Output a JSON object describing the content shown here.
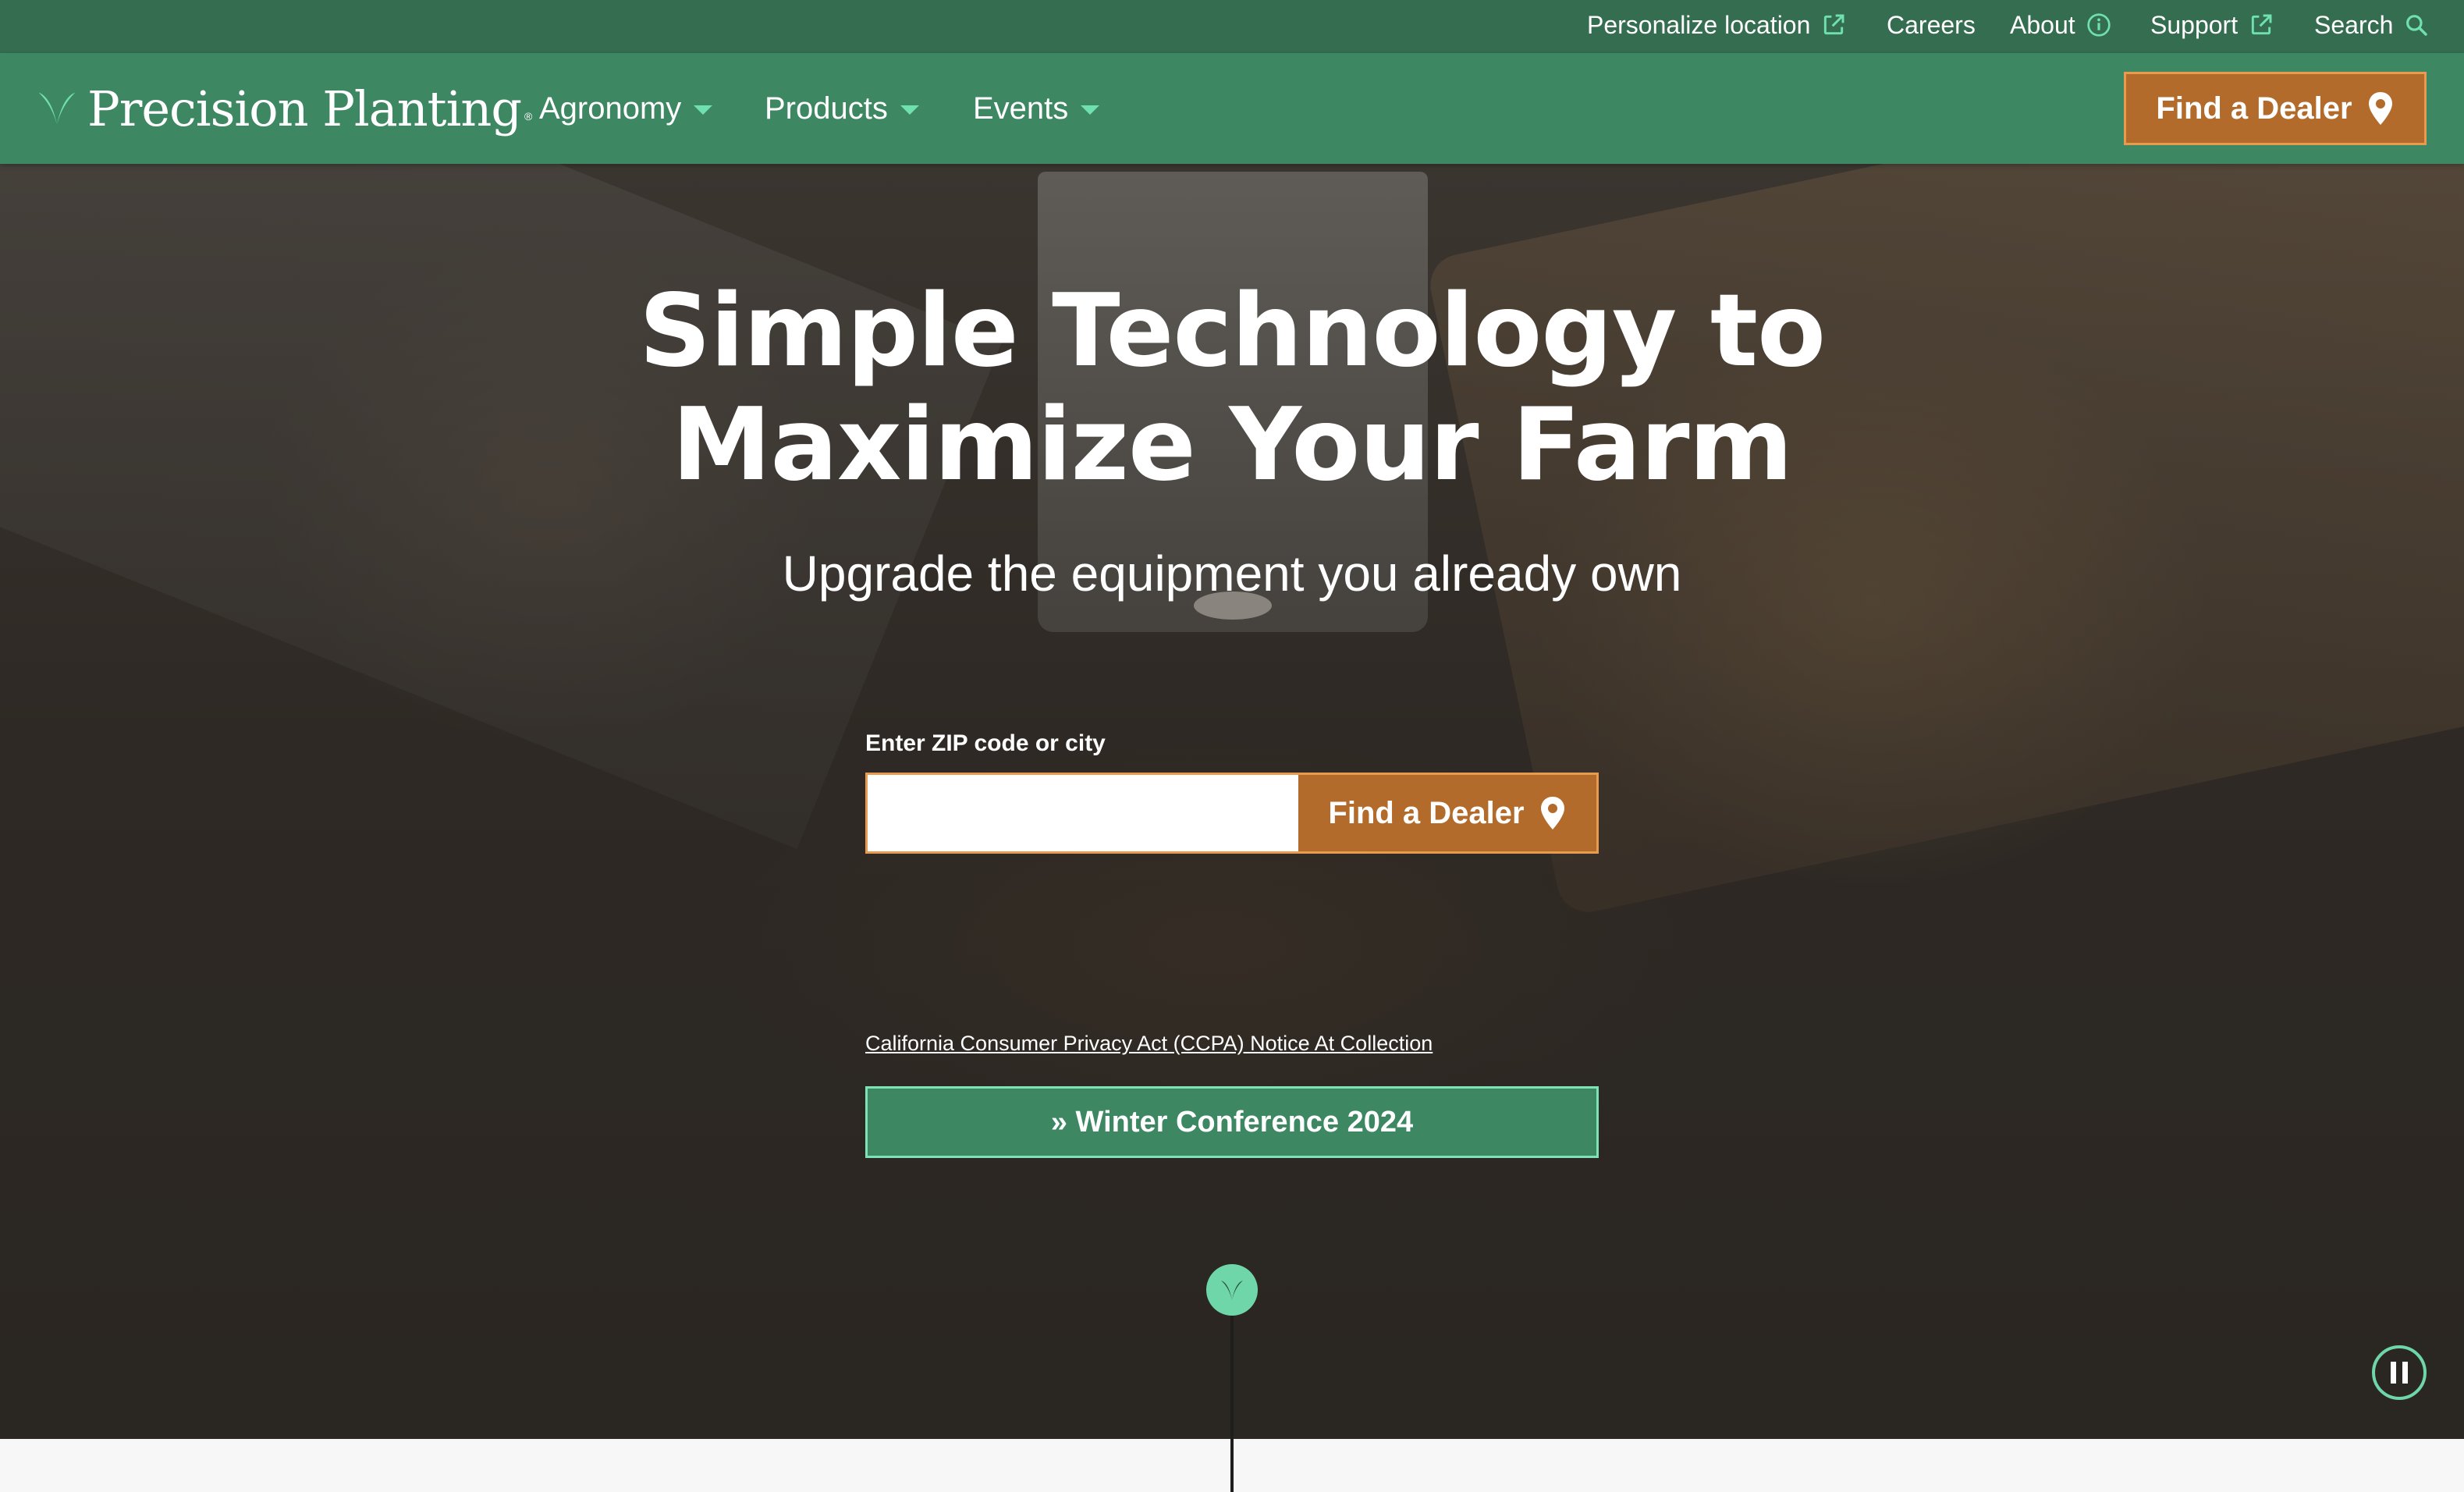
{
  "utility_nav": {
    "items": [
      {
        "label": "Personalize location",
        "icon": "external-link-icon"
      },
      {
        "label": "Careers",
        "icon": ""
      },
      {
        "label": "About",
        "icon": "info-icon"
      },
      {
        "label": "Support",
        "icon": "external-link-icon"
      },
      {
        "label": "Search",
        "icon": "search-icon"
      }
    ]
  },
  "main_nav": {
    "logo_text": "Precision Planting",
    "logo_mark": "sprout-logo-icon",
    "items": [
      {
        "label": "Agronomy"
      },
      {
        "label": "Products"
      },
      {
        "label": "Events"
      }
    ],
    "find_dealer_label": "Find a Dealer"
  },
  "hero": {
    "title_line1": "Simple Technology to",
    "title_line2": "Maximize Your Farm",
    "subtitle": "Upgrade the equipment you already own",
    "zip_label": "Enter ZIP code or city",
    "zip_value": "",
    "find_dealer_label": "Find a Dealer",
    "ccpa_link": "California Consumer Privacy Act (CCPA) Notice At Collection",
    "winter_conference": "» Winter Conference 2024"
  },
  "colors": {
    "utility_bar": "#356d50",
    "nav_green": "#3d8762",
    "accent_mint": "#6fd6aa",
    "dealer_orange": "#b26b2b",
    "dealer_border": "#e89a4f"
  }
}
